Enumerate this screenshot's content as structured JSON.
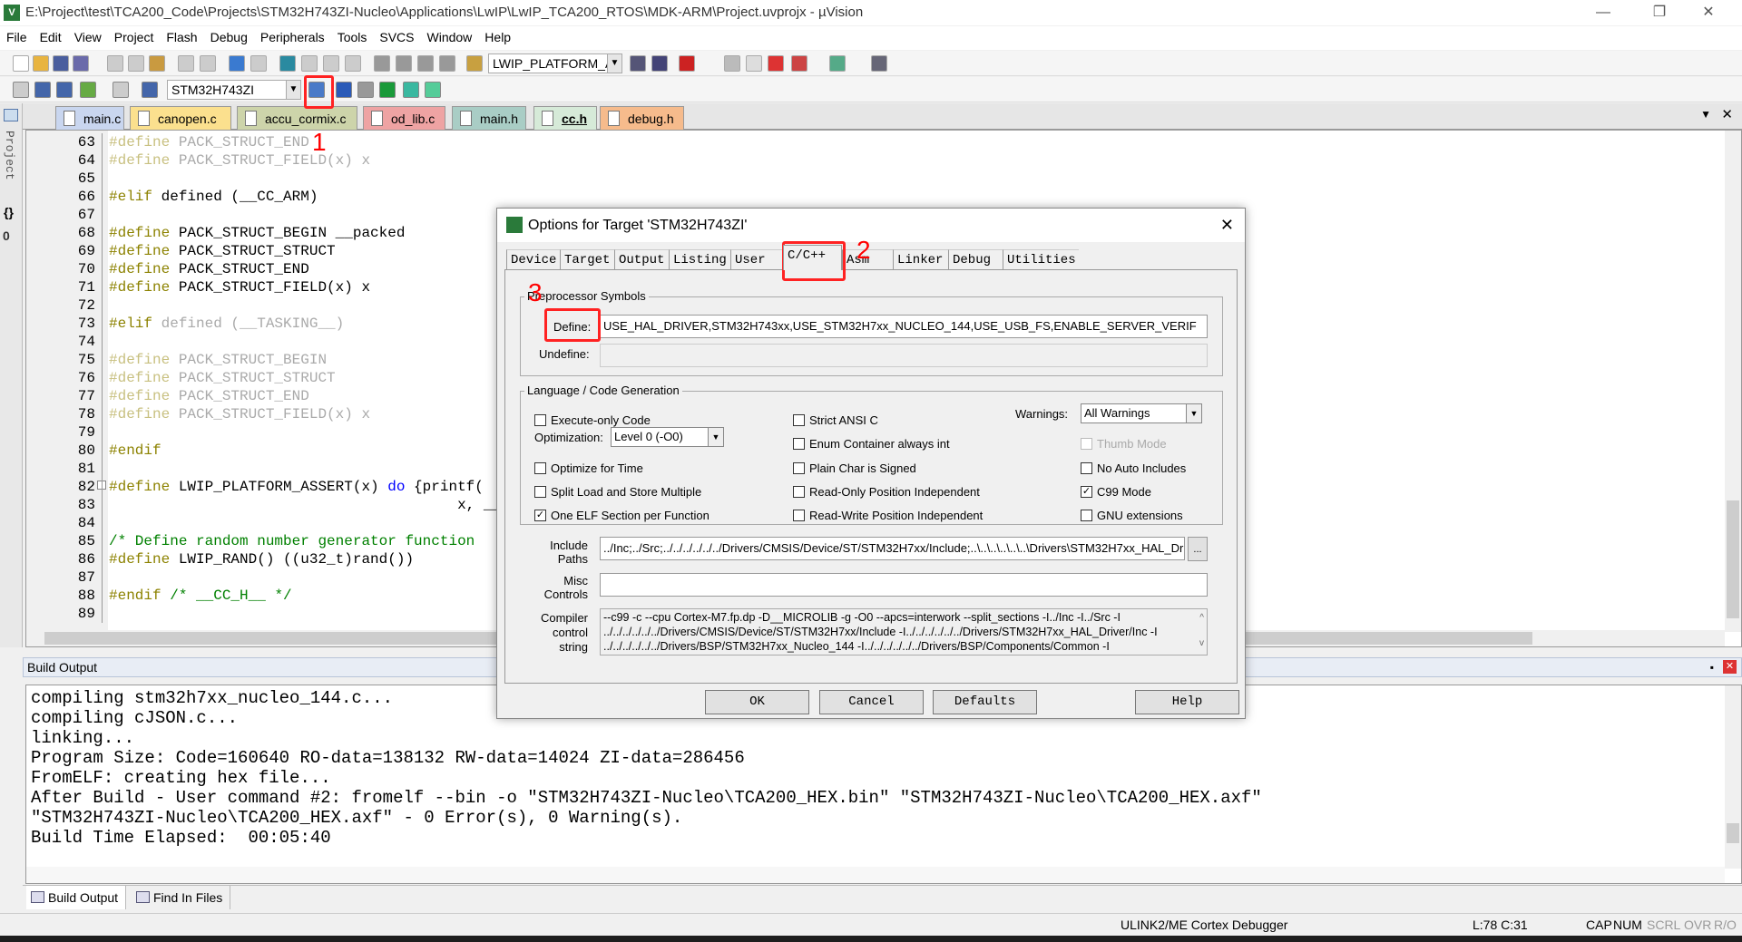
{
  "window": {
    "title": "E:\\Project\\test\\TCA200_Code\\Projects\\STM32H743ZI-Nucleo\\Applications\\LwIP\\LwIP_TCA200_RTOS\\MDK-ARM\\Project.uvprojx - µVision",
    "minimize": "—",
    "restore": "❐",
    "close": "✕"
  },
  "menu": [
    "File",
    "Edit",
    "View",
    "Project",
    "Flash",
    "Debug",
    "Peripherals",
    "Tools",
    "SVCS",
    "Window",
    "Help"
  ],
  "toolbar": {
    "find_combo": "LWIP_PLATFORM_A:",
    "target_combo": "STM32H743ZI"
  },
  "sidebar": {
    "project_label": "Project",
    "functions_icon": "{}",
    "templates_icon": "0"
  },
  "file_tabs": [
    {
      "label": "main.c",
      "color": "#c9d6ef"
    },
    {
      "label": "canopen.c",
      "color": "#fbe08e"
    },
    {
      "label": "accu_cormix.c",
      "color": "#cdd4aa"
    },
    {
      "label": "od_lib.c",
      "color": "#eea3a3"
    },
    {
      "label": "main.h",
      "color": "#a9cdc5"
    },
    {
      "label": "cc.h",
      "color": "#d6ead8",
      "active": true
    },
    {
      "label": "debug.h",
      "color": "#f6bb8c"
    }
  ],
  "code_lines": [
    {
      "n": "63",
      "seg": [
        [
          "dimkw",
          "#define "
        ],
        [
          "dim",
          "PACK_STRUCT_END"
        ]
      ]
    },
    {
      "n": "64",
      "seg": [
        [
          "dimkw",
          "#define "
        ],
        [
          "dim",
          "PACK_STRUCT_FIELD(x) x"
        ]
      ]
    },
    {
      "n": "65",
      "seg": []
    },
    {
      "n": "66",
      "seg": [
        [
          "kw",
          "#elif "
        ],
        [
          "id",
          "defined (__CC_ARM)"
        ]
      ]
    },
    {
      "n": "67",
      "seg": []
    },
    {
      "n": "68",
      "seg": [
        [
          "kw",
          "#define "
        ],
        [
          "id",
          "PACK_STRUCT_BEGIN __packed"
        ]
      ]
    },
    {
      "n": "69",
      "seg": [
        [
          "kw",
          "#define "
        ],
        [
          "id",
          "PACK_STRUCT_STRUCT"
        ]
      ]
    },
    {
      "n": "70",
      "seg": [
        [
          "kw",
          "#define "
        ],
        [
          "id",
          "PACK_STRUCT_END"
        ]
      ]
    },
    {
      "n": "71",
      "seg": [
        [
          "kw",
          "#define "
        ],
        [
          "id",
          "PACK_STRUCT_FIELD(x) x"
        ]
      ]
    },
    {
      "n": "72",
      "seg": []
    },
    {
      "n": "73",
      "seg": [
        [
          "kw",
          "#elif "
        ],
        [
          "dim",
          "defined (__TASKING__)"
        ]
      ]
    },
    {
      "n": "74",
      "seg": []
    },
    {
      "n": "75",
      "seg": [
        [
          "dimkw",
          "#define "
        ],
        [
          "dim",
          "PACK_STRUCT_BEGIN"
        ]
      ]
    },
    {
      "n": "76",
      "seg": [
        [
          "dimkw",
          "#define "
        ],
        [
          "dim",
          "PACK_STRUCT_STRUCT"
        ]
      ]
    },
    {
      "n": "77",
      "seg": [
        [
          "dimkw",
          "#define "
        ],
        [
          "dim",
          "PACK_STRUCT_END"
        ]
      ]
    },
    {
      "n": "78",
      "seg": [
        [
          "dimkw",
          "#define "
        ],
        [
          "dim",
          "PACK_STRUCT_FIELD(x) x"
        ]
      ]
    },
    {
      "n": "79",
      "seg": []
    },
    {
      "n": "80",
      "seg": [
        [
          "kw",
          "#endif"
        ]
      ]
    },
    {
      "n": "81",
      "seg": []
    },
    {
      "n": "82",
      "seg": [
        [
          "kw",
          "#define "
        ],
        [
          "id",
          "LWIP_PLATFORM_ASSERT(x) "
        ],
        [
          "bl",
          "do"
        ],
        [
          "id",
          " {printf("
        ]
      ]
    },
    {
      "n": "83",
      "seg": [
        [
          "id",
          "                                        x, __L"
        ]
      ]
    },
    {
      "n": "84",
      "seg": []
    },
    {
      "n": "85",
      "seg": [
        [
          "cm",
          "/* Define random number generator function"
        ]
      ]
    },
    {
      "n": "86",
      "seg": [
        [
          "kw",
          "#define "
        ],
        [
          "id",
          "LWIP_RAND() ((u32_t)rand())"
        ]
      ]
    },
    {
      "n": "87",
      "seg": []
    },
    {
      "n": "88",
      "seg": [
        [
          "kw",
          "#endif "
        ],
        [
          "cm",
          "/* __CC_H__ */"
        ]
      ]
    },
    {
      "n": "89",
      "seg": []
    }
  ],
  "build_output": {
    "title": "Build Output",
    "lines": [
      "compiling stm32h7xx_nucleo_144.c...",
      "compiling cJSON.c...",
      "linking...",
      "Program Size: Code=160640 RO-data=138132 RW-data=14024 ZI-data=286456",
      "FromELF: creating hex file...",
      "After Build - User command #2: fromelf --bin -o \"STM32H743ZI-Nucleo\\TCA200_HEX.bin\" \"STM32H743ZI-Nucleo\\TCA200_HEX.axf\"",
      "\"STM32H743ZI-Nucleo\\TCA200_HEX.axf\" - 0 Error(s), 0 Warning(s).",
      "Build Time Elapsed:  00:05:40"
    ]
  },
  "bottom_tabs": [
    "Build Output",
    "Find In Files"
  ],
  "status": {
    "debugger": "ULINK2/ME Cortex Debugger",
    "position": "L:78 C:31",
    "cap": "CAP",
    "num": "NUM",
    "scrl": "SCRL",
    "ovr": "OVR",
    "ro": "R/O"
  },
  "dialog": {
    "title": "Options for Target 'STM32H743ZI'",
    "close": "✕",
    "tabs": [
      "Device",
      "Target",
      "Output",
      "Listing",
      "User",
      "C/C++",
      "Asm",
      "Linker",
      "Debug",
      "Utilities"
    ],
    "active_tab": "C/C++",
    "preprocessor": {
      "group": "Preprocessor Symbols",
      "define_label": "Define:",
      "define_value": "USE_HAL_DRIVER,STM32H743xx,USE_STM32H7xx_NUCLEO_144,USE_USB_FS,ENABLE_SERVER_VERIF",
      "undefine_label": "Undefine:",
      "undefine_value": ""
    },
    "codegen": {
      "group": "Language / Code Generation",
      "optimization_label": "Optimization:",
      "optimization_value": "Level 0 (-O0)",
      "warnings_label": "Warnings:",
      "warnings_value": "All Warnings",
      "checkboxes": [
        {
          "label": "Execute-only Code",
          "checked": false,
          "enabled": true
        },
        {
          "label": "Optimize for Time",
          "checked": false,
          "enabled": true
        },
        {
          "label": "Split Load and Store Multiple",
          "checked": false,
          "enabled": true
        },
        {
          "label": "One ELF Section per Function",
          "checked": true,
          "enabled": true
        },
        {
          "label": "Strict ANSI C",
          "checked": false,
          "enabled": true
        },
        {
          "label": "Enum Container always int",
          "checked": false,
          "enabled": true
        },
        {
          "label": "Plain Char is Signed",
          "checked": false,
          "enabled": true
        },
        {
          "label": "Read-Only Position Independent",
          "checked": false,
          "enabled": true
        },
        {
          "label": "Read-Write Position Independent",
          "checked": false,
          "enabled": true
        },
        {
          "label": "Thumb Mode",
          "checked": false,
          "enabled": false
        },
        {
          "label": "No Auto Includes",
          "checked": false,
          "enabled": true
        },
        {
          "label": "C99 Mode",
          "checked": true,
          "enabled": true
        },
        {
          "label": "GNU extensions",
          "checked": false,
          "enabled": true
        }
      ]
    },
    "include_label_1": "Include",
    "include_label_2": "Paths",
    "include_value": "../Inc;../Src;../../../../../../Drivers/CMSIS/Device/ST/STM32H7xx/Include;..\\..\\..\\..\\..\\..\\Drivers\\STM32H7xx_HAL_Dr",
    "browse": "...",
    "misc_label_1": "Misc",
    "misc_label_2": "Controls",
    "misc_value": "",
    "compiler_label_1": "Compiler",
    "compiler_label_2": "control",
    "compiler_label_3": "string",
    "compiler_lines": [
      "--c99 -c --cpu Cortex-M7.fp.dp -D__MICROLIB -g -O0 --apcs=interwork --split_sections -I../Inc -I../Src -I",
      "../../../../../../Drivers/CMSIS/Device/ST/STM32H7xx/Include -I../../../../../../Drivers/STM32H7xx_HAL_Driver/Inc -I",
      "../../../../../../Drivers/BSP/STM32H7xx_Nucleo_144 -I../../../../../../Drivers/BSP/Components/Common -I"
    ],
    "buttons": {
      "ok": "OK",
      "cancel": "Cancel",
      "defaults": "Defaults",
      "help": "Help"
    }
  },
  "annotations": [
    "1",
    "2",
    "3"
  ],
  "colors": {
    "annotation": "#ff2222",
    "define_keyword": "#8c8200",
    "comment": "#008000"
  }
}
